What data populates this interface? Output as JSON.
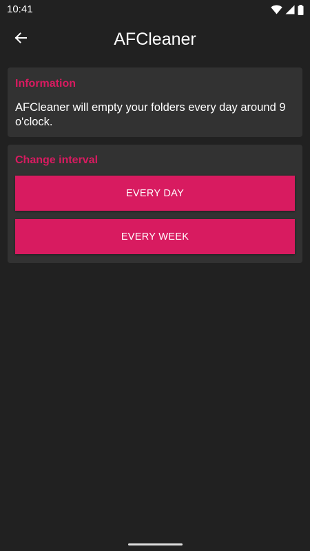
{
  "status_bar": {
    "time": "10:41",
    "icons": [
      "wifi-icon",
      "signal-icon",
      "battery-icon"
    ]
  },
  "app_bar": {
    "title": "AFCleaner",
    "back_icon": "arrow-back-icon"
  },
  "info_card": {
    "heading": "Information",
    "text": "AFCleaner will empty your folders every day around 9 o'clock."
  },
  "interval_card": {
    "heading": "Change interval",
    "buttons": [
      {
        "label": "EVERY DAY"
      },
      {
        "label": "EVERY WEEK"
      }
    ]
  },
  "colors": {
    "background": "#212121",
    "card": "#323232",
    "accent": "#d81b60",
    "text": "#ffffff"
  }
}
